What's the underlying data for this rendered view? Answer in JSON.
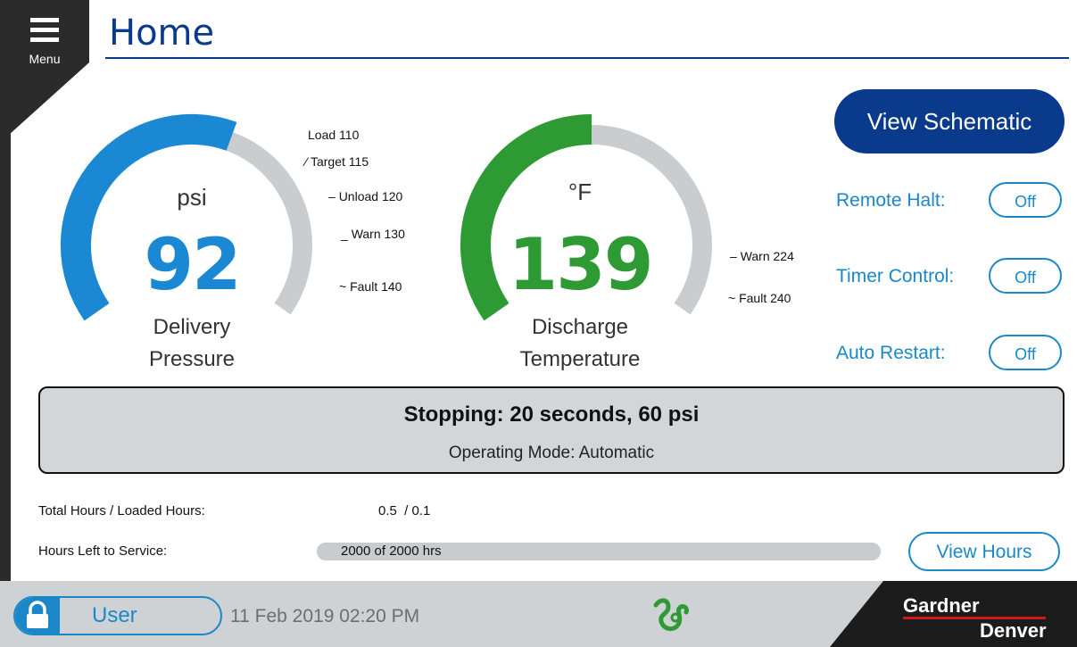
{
  "header": {
    "menu_label": "Menu",
    "title": "Home"
  },
  "pressure_gauge": {
    "unit": "psi",
    "value": "92",
    "label_line1": "Delivery",
    "label_line2": "Pressure",
    "color": "#1a88d2",
    "fill_fraction": 0.58,
    "ticks": [
      "Load 110",
      "Target 115",
      "Unload 120",
      "Warn 130",
      "Fault 140"
    ]
  },
  "temperature_gauge": {
    "unit": "°F",
    "value": "139",
    "label_line1": "Discharge",
    "label_line2": "Temperature",
    "color": "#2e9a34",
    "fill_fraction": 0.5,
    "ticks": [
      "Warn 224",
      "Fault 240"
    ]
  },
  "controls": {
    "view_schematic": "View Schematic",
    "remote_halt": {
      "label": "Remote Halt:",
      "state": "Off"
    },
    "timer_control": {
      "label": "Timer Control:",
      "state": "Off"
    },
    "auto_restart": {
      "label": "Auto Restart:",
      "state": "Off"
    }
  },
  "status": {
    "main": "Stopping: 20 seconds, 60 psi",
    "mode": "Operating Mode: Automatic"
  },
  "hours": {
    "total_label": "Total Hours / Loaded Hours:",
    "total_value": "0.5  / 0.1",
    "service_label": "Hours Left to Service:",
    "service_value": "2000 of 2000 hrs",
    "service_fraction": 1.0,
    "view_hours": "View Hours"
  },
  "footer": {
    "user_label": "User",
    "datetime": "11 Feb 2019  02:20 PM",
    "brand_line1": "Gardner",
    "brand_line2": "Denver"
  },
  "colors": {
    "navy": "#0a3a8c",
    "accent_blue": "#1a88c8",
    "footer_gray": "#cfd2d4"
  }
}
